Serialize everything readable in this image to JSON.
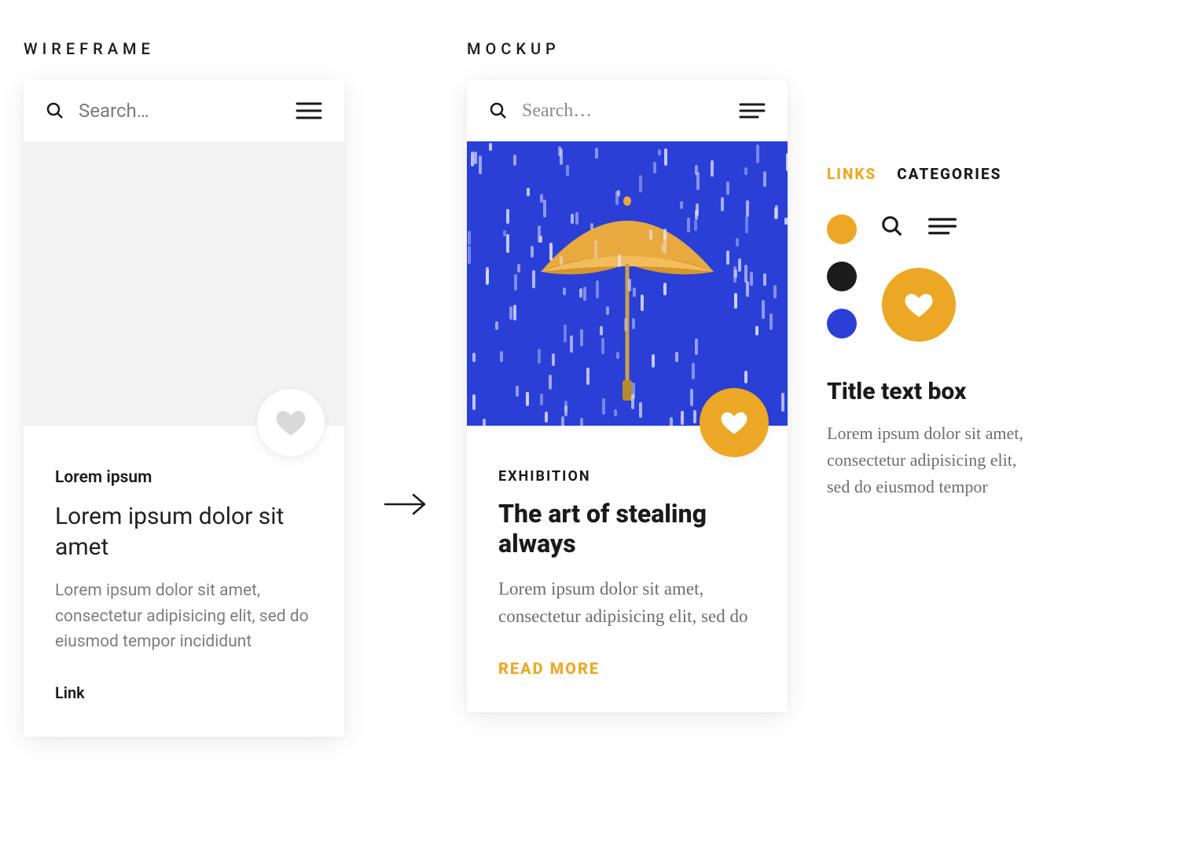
{
  "labels": {
    "wireframe": "WIREFRAME",
    "mockup": "MOCKUP"
  },
  "colors": {
    "accent": "#eca824",
    "dark": "#1c1c1c",
    "brand_blue": "#2a3fd6"
  },
  "wireframe": {
    "search_placeholder": "Search…",
    "category": "Lorem ipsum",
    "title": "Lorem ipsum dolor sit amet",
    "body": "Lorem ipsum dolor sit amet, consectetur adipisicing elit, sed do eiusmod tempor incididunt",
    "link": "Link"
  },
  "mockup": {
    "search_placeholder": "Search…",
    "category": "EXHIBITION",
    "title": "The art of stealing always",
    "body": "Lorem ipsum dolor sit amet, consectetur adipisicing elit, sed do",
    "link": "READ MORE"
  },
  "styleguide": {
    "tabs": {
      "links": "LINKS",
      "categories": "CATEGORIES"
    },
    "title": "Title text box",
    "body": "Lorem ipsum dolor sit amet, consectetur adipisicing elit, sed do eiusmod tempor"
  }
}
